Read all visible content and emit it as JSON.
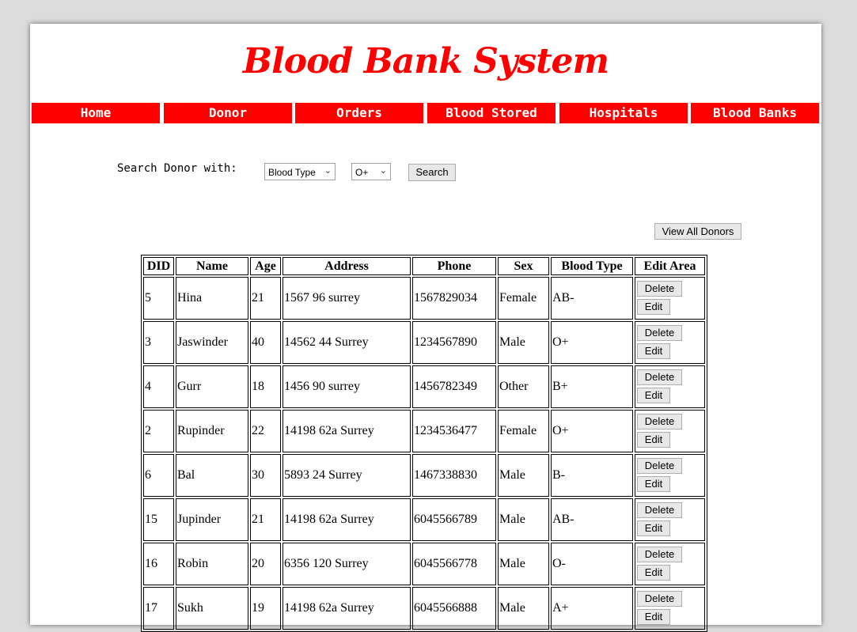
{
  "header": {
    "title": "Blood Bank System"
  },
  "nav": {
    "items": [
      {
        "label": "Home"
      },
      {
        "label": "Donor"
      },
      {
        "label": "Orders"
      },
      {
        "label": "Blood Stored"
      },
      {
        "label": "Hospitals"
      },
      {
        "label": "Blood Banks"
      }
    ]
  },
  "search": {
    "label": "Search Donor with:",
    "field_value": "Blood Type",
    "type_value": "O+",
    "button_label": "Search"
  },
  "view_all_label": "View All Donors",
  "table": {
    "columns": [
      "DID",
      "Name",
      "Age",
      "Address",
      "Phone",
      "Sex",
      "Blood Type",
      "Edit Area"
    ],
    "delete_label": "Delete",
    "edit_label": "Edit",
    "rows": [
      [
        "5",
        "Hina",
        "21",
        "1567 96 surrey",
        "1567829034",
        "Female",
        "AB-"
      ],
      [
        "3",
        "Jaswinder",
        "40",
        "14562 44 Surrey",
        "1234567890",
        "Male",
        "O+"
      ],
      [
        "4",
        "Gurr",
        "18",
        "1456 90 surrey",
        "1456782349",
        "Other",
        "B+"
      ],
      [
        "2",
        "Rupinder",
        "22",
        "14198 62a Surrey",
        "1234536477",
        "Female",
        "O+"
      ],
      [
        "6",
        "Bal",
        "30",
        "5893 24 Surrey",
        "1467338830",
        "Male",
        "B-"
      ],
      [
        "15",
        "Jupinder",
        "21",
        "14198 62a Surrey",
        "6045566789",
        "Male",
        "AB-"
      ],
      [
        "16",
        "Robin",
        "20",
        "6356 120 Surrey",
        "6045566778",
        "Male",
        "O-"
      ],
      [
        "17",
        "Sukh",
        "19",
        "14198 62a Surrey",
        "6045566888",
        "Male",
        "A+"
      ]
    ]
  }
}
